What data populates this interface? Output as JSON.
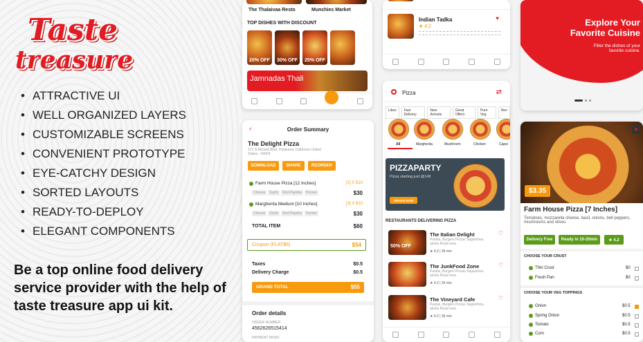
{
  "brand": {
    "line1": "Taste",
    "line2": "treasure"
  },
  "features": [
    "ATTRACTIVE UI",
    "WELL ORGANIZED LAYERS",
    "CUSTOMIZABLE SCREENS",
    "CONVENIENT PROTOTYPE",
    "EYE-CATCHY DESIGN",
    "SORTED LAYOUTS",
    "READY-TO-DEPLOY",
    "ELEGANT COMPONENTS"
  ],
  "tagline": "Be a top online food delivery service provider with the help of taste treasure app ui kit.",
  "home": {
    "restaurants": [
      "The Thalaivaa Resto",
      "Munchies Market"
    ],
    "section_title": "TOP DISHES WITH DISCOUNT",
    "discounts": [
      "20% OFF",
      "30% OFF",
      "25% OFF"
    ],
    "banner": "Jamnadas Thali"
  },
  "order": {
    "title": "Order Summary",
    "restaurant": "The Delight Pizza",
    "address": "171 N Mcmed Blvd, Petaluma, California United States - 94954",
    "buttons": [
      "DOWNLOAD",
      "SHARE",
      "REORDER"
    ],
    "items": [
      {
        "name": "Farm House Pizza [12 Inches]",
        "qty": "[2] X $10",
        "price": "$30",
        "tags": [
          "Cheese",
          "Garlic",
          "Red Paprika",
          "Panner"
        ]
      },
      {
        "name": "Margherita Medium [10 Inches]",
        "qty": "[3] X $10",
        "price": "$30",
        "tags": [
          "Cheese",
          "Garlic",
          "Red Paprika",
          "Panner"
        ]
      }
    ],
    "total_label": "TOTAL ITEM",
    "total_value": "$60",
    "coupon_label": "Coupon (FLAT$6)",
    "coupon_value": "$54",
    "taxes_label": "Taxes",
    "taxes_value": "$0.5",
    "delivery_label": "Delivery Charge",
    "delivery_value": "$0.5",
    "grand_label": "GRAND TOTAL",
    "grand_value": "$55",
    "details_title": "Order details",
    "order_number_label": "ORDER NUMBER",
    "order_number": "4562626515414",
    "payment_label": "PAYMENT MODE"
  },
  "fav": {
    "name": "Indian Tadka",
    "rating": "★ 4.2"
  },
  "pizza": {
    "search": "Pizza",
    "filters": [
      "Likes",
      "Fast Delivery",
      "New Arrivals",
      "Great Offers",
      "Pure Veg",
      "Non"
    ],
    "types": [
      "All",
      "Margherita",
      "Mushroom",
      "Chicken",
      "Capsi"
    ],
    "banner_title": "PIZZAPARTY",
    "banner_sub": "Pizza starting just @149",
    "banner_btn": "ORDER NOW",
    "section": "RESTAURANTS DELIVERING PIZZA",
    "restaurants": [
      {
        "name": "The Italian Delight",
        "desc": "Pastas, Burgers Pizzas Sagwiches, aksha Road mea",
        "meta": "★ 4.2 | 36 min",
        "badge": "50% OFF"
      },
      {
        "name": "The JunkFood Zone",
        "desc": "Pastas, Burgers Pizzas Sagwiches, aksha Road mea",
        "meta": "★ 4.2 | 36 min"
      },
      {
        "name": "The Vineyard Cafe",
        "desc": "Pastas, Burgers Pizzas Sagwiches, aksha Road mea",
        "meta": "★ 4.2 | 36 min"
      }
    ]
  },
  "explore": {
    "title1": "Explore Your",
    "title2": "Favorite Cuisine",
    "sub1": "Filter the dishes of your",
    "sub2": "favorite cuisine."
  },
  "detail": {
    "price": "$3.35",
    "name": "Farm House Pizza [7 Inches]",
    "desc": "Tomatoes, mozzarella cheese, basil, onions, bell peppers, mushrooms and olives.",
    "pills": [
      "Delivery Free",
      "Ready in 10-20min",
      "★ 4.2"
    ],
    "crust_title": "CHOOSE YOUR CRUST",
    "crust": [
      {
        "name": "Thin Crust",
        "price": "$0"
      },
      {
        "name": "Fresh Pan",
        "price": "$0"
      }
    ],
    "topping_title": "CHOOSE YOUR VEG TOPPINGS",
    "toppings": [
      {
        "name": "Onion",
        "price": "$0.5"
      },
      {
        "name": "Spring Onion",
        "price": "$0.5"
      },
      {
        "name": "Tomato",
        "price": "$0.5"
      },
      {
        "name": "Corn",
        "price": "$0.5"
      }
    ]
  }
}
